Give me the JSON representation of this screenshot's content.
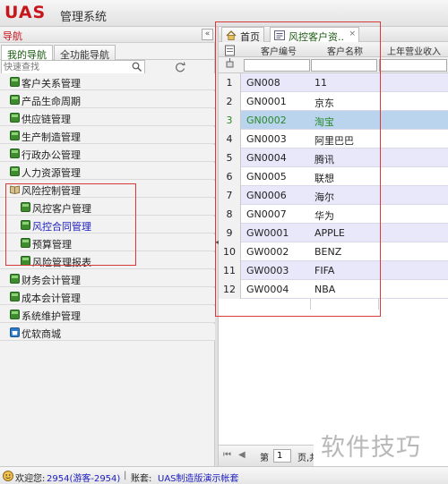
{
  "app": {
    "logo": "UAS",
    "title": "管理系统"
  },
  "left": {
    "header": "导航",
    "collapse_glyph": "«",
    "tabs": [
      "我的导航",
      "全功能导航"
    ],
    "search_placeholder": "快速查找",
    "items": [
      {
        "label": "客户关系管理",
        "level": 0,
        "icon": "module-icon"
      },
      {
        "label": "产品生命周期",
        "level": 0,
        "icon": "module-icon"
      },
      {
        "label": "供应链管理",
        "level": 0,
        "icon": "module-icon"
      },
      {
        "label": "生产制造管理",
        "level": 0,
        "icon": "module-icon"
      },
      {
        "label": "行政办公管理",
        "level": 0,
        "icon": "module-icon"
      },
      {
        "label": "人力资源管理",
        "level": 0,
        "icon": "module-icon"
      },
      {
        "label": "风险控制管理",
        "level": 0,
        "icon": "open-book-icon"
      },
      {
        "label": "风控客户管理",
        "level": 1,
        "icon": "module-icon"
      },
      {
        "label": "风控合同管理",
        "level": 1,
        "icon": "module-icon",
        "link": true
      },
      {
        "label": "预算管理",
        "level": 1,
        "icon": "module-icon"
      },
      {
        "label": "风险管理报表",
        "level": 1,
        "icon": "module-icon"
      },
      {
        "label": "财务会计管理",
        "level": 0,
        "icon": "module-icon"
      },
      {
        "label": "成本会计管理",
        "level": 0,
        "icon": "module-icon"
      },
      {
        "label": "系统维护管理",
        "level": 0,
        "icon": "module-icon"
      },
      {
        "label": "优软商城",
        "level": 0,
        "icon": "mall-icon"
      }
    ]
  },
  "main": {
    "tabs": [
      {
        "label": "首页",
        "icon": "home-icon"
      },
      {
        "label": "风控客户资..",
        "icon": "form-icon",
        "close": "×"
      }
    ],
    "columns": [
      "客户编号",
      "客户名称",
      "上年营业收入"
    ],
    "rows": [
      {
        "num": "1",
        "code": "GN008",
        "name": "11"
      },
      {
        "num": "2",
        "code": "GN0001",
        "name": "京东"
      },
      {
        "num": "3",
        "code": "GN0002",
        "name": "淘宝"
      },
      {
        "num": "4",
        "code": "GN0003",
        "name": "阿里巴巴"
      },
      {
        "num": "5",
        "code": "GN0004",
        "name": "腾讯"
      },
      {
        "num": "6",
        "code": "GN0005",
        "name": "联想"
      },
      {
        "num": "7",
        "code": "GN0006",
        "name": "海尔"
      },
      {
        "num": "8",
        "code": "GN0007",
        "name": "华为"
      },
      {
        "num": "9",
        "code": "GW0001",
        "name": "APPLE"
      },
      {
        "num": "10",
        "code": "GW0002",
        "name": "BENZ"
      },
      {
        "num": "11",
        "code": "GW0003",
        "name": "FIFA"
      },
      {
        "num": "12",
        "code": "GW0004",
        "name": "NBA"
      }
    ],
    "selected_row_index": 2,
    "pager": {
      "page_label": "第",
      "page_value": "1",
      "page_suffix": "页,共"
    }
  },
  "status": {
    "welcome": "欢迎您:",
    "user": "2954(游客-2954)",
    "separator": "|",
    "account_label": "账套:",
    "account": "UAS制造版演示帐套"
  },
  "watermark": "软件技巧",
  "colors": {
    "brand": "#c8161d",
    "selected_row": "#b9d4ec",
    "alt_row": "#e9e8fb",
    "highlight": "#d63a3a"
  }
}
